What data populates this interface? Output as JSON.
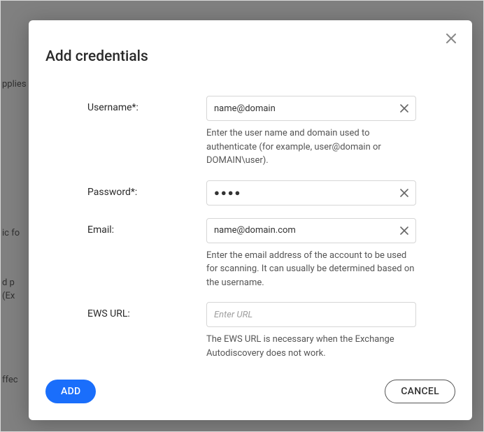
{
  "dialog": {
    "title": "Add credentials",
    "fields": {
      "username": {
        "label": "Username*:",
        "value": "name@domain",
        "help": "Enter the user name and domain used to authenticate (for example, user@domain or DOMAIN\\user)."
      },
      "password": {
        "label": "Password*:",
        "value_mask": "●●●●"
      },
      "email": {
        "label": "Email:",
        "value": "name@domain.com",
        "help": "Enter the email address of the account to be used for scanning. It can usually be determined based on the username."
      },
      "ews_url": {
        "label": "EWS URL:",
        "placeholder": "Enter URL",
        "help": "The EWS URL is necessary when the Exchange Autodiscovery does not work."
      }
    },
    "actions": {
      "add": "ADD",
      "cancel": "CANCEL"
    }
  },
  "background": {
    "t1": "pplies",
    "t2": "ic fo",
    "t3": "d p",
    "t4": "(Ex",
    "t5": "ffec"
  }
}
